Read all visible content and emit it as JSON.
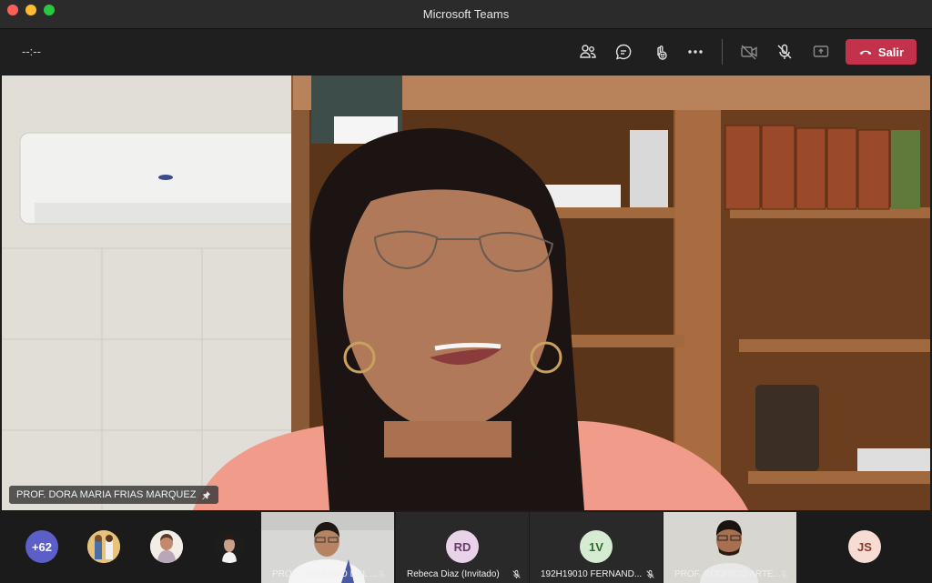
{
  "window": {
    "title": "Microsoft Teams"
  },
  "toolbar": {
    "timer": "--:--",
    "icons": [
      "participants-icon",
      "chat-icon",
      "reactions-icon",
      "more-icon",
      "camera-off-icon",
      "mic-off-icon",
      "share-icon"
    ],
    "leave_label": "Salir",
    "leave_color": "#c4314b"
  },
  "main_video": {
    "speaker_name": "PROF. DORA MARIA FRIAS MARQUEZ"
  },
  "strip": {
    "overflow_count": "+62",
    "overflow_color": "#5b5fc7",
    "tiles": [
      {
        "name": "PROF. GERARDO DEL ...",
        "type": "video"
      },
      {
        "name": "Rebeca Diaz (Invitado)",
        "initials": "RD",
        "color": "#e8d3e8"
      },
      {
        "name": "192H19010 FERNAND...",
        "initials": "1V",
        "color": "#d6ecd2"
      },
      {
        "name": "PROF. RODRIGO ARTE...",
        "type": "video"
      }
    ],
    "last_initials": "JS",
    "last_color": "#f6dcd2"
  }
}
